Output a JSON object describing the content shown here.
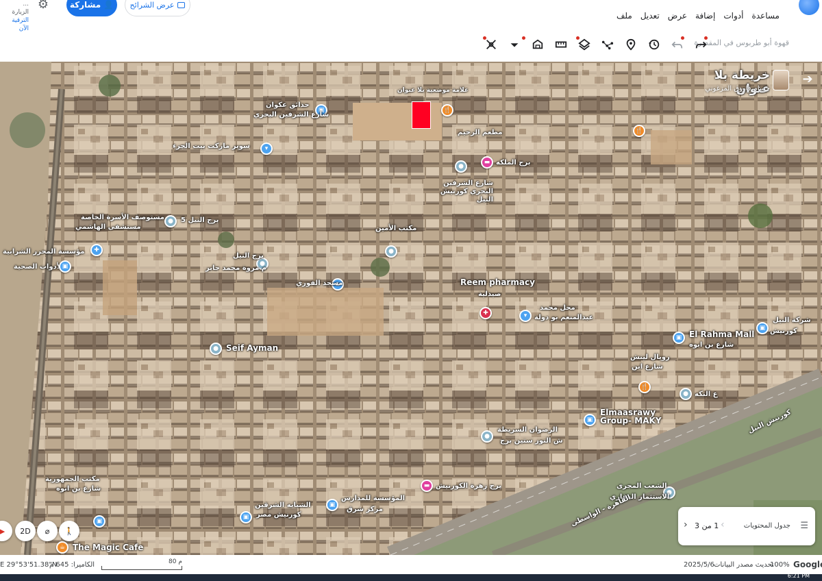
{
  "app": {
    "left_info": [
      "...",
      "الزيارة",
      "الترقية الآن"
    ],
    "share_label": "مشاركة",
    "slides_label": "عرض الشرائح",
    "menu": [
      "ملف",
      "تعديل",
      "عرض",
      "إضافة",
      "أدوات",
      "مساعدة"
    ],
    "search_placeholder": "قهوة أبو طربوس في المقصرة"
  },
  "toolbar_icons": [
    "redo-icon",
    "undo-icon",
    "history-icon",
    "place-marker-icon",
    "path-icon",
    "layers-icon",
    "ruler-icon",
    "home-view-icon",
    "more-icon",
    "satellite-off-icon"
  ],
  "map_title": {
    "name": "خريطة بلا عنوان",
    "author": "حسام فاروق المزغوني"
  },
  "places": [
    {
      "label": "حدائق عكوان",
      "sub": "شارع الشرفين البحري",
      "pin": "blue"
    },
    {
      "label": "علامة موضعية بلا عنوان",
      "sub": "",
      "pin": "orange"
    },
    {
      "label": "مطعم الرحيم",
      "sub": "",
      "pin": "orange"
    },
    {
      "label": "سوبر ماركت بيت الجزء",
      "sub": "",
      "pin": "blue"
    },
    {
      "label": "برج الملكه",
      "sub": "",
      "pin": "pink"
    },
    {
      "label": "شارع الشرفين البحري كورنيش النيل",
      "sub": "",
      "pin": "grey"
    },
    {
      "label": "برج النيل 5",
      "sub": "",
      "pin": "grey"
    },
    {
      "label": "مستوصف الأسرة الخاصة",
      "sub": "مستشفى الهاشمي",
      "pin": "blue"
    },
    {
      "label": "مؤسسة المحرر الشرابية",
      "sub": "والأدوات الصحية",
      "pin": "blue"
    },
    {
      "label": "برج النيل",
      "sub": "م مروة محمد جابر",
      "pin": "grey"
    },
    {
      "label": "مكتب الأمين",
      "sub": "",
      "pin": "grey"
    },
    {
      "label": "مسجد الفوري",
      "sub": "",
      "pin": "blue"
    },
    {
      "label": "Reem pharmacy",
      "sub": "صيدلية",
      "pin": "red"
    },
    {
      "label": "محل محمد",
      "sub": "عبدالمنعم بو دولة",
      "pin": "blue"
    },
    {
      "label": "Seif Ayman",
      "sub": "",
      "pin": "grey"
    },
    {
      "label": "El Rahma Mall",
      "sub": "شارع بن ابوه",
      "pin": "blue"
    },
    {
      "label": "شركة النيل",
      "sub": "كورنيش",
      "pin": "blue"
    },
    {
      "label": "رويال لينش",
      "sub": "شارع ابن",
      "pin": "orange"
    },
    {
      "label": "ع النكه",
      "sub": "",
      "pin": "grey"
    },
    {
      "label": "Elmaasrawy Group- MAKY",
      "sub": "",
      "pin": "blue"
    },
    {
      "label": "الرضوان السريطة",
      "sub": "ش النور ستين برج",
      "pin": "grey"
    },
    {
      "label": "برج زهرة الكورنيش",
      "sub": "",
      "pin": "pink"
    },
    {
      "label": "المؤسسة للمدارس",
      "sub": "مركز شرق",
      "pin": "blue"
    },
    {
      "label": "الشبابه الشرقين",
      "sub": "كورنيش مصر",
      "pin": "blue"
    },
    {
      "label": "مكتب الجمهورية",
      "sub": "شارع بن ابوه",
      "pin": "blue"
    },
    {
      "label": "الشعب المجرى",
      "sub": "الاستثمار العقاري",
      "pin": "grey"
    },
    {
      "label": "The Magic Cafe",
      "sub": "",
      "pin": "orange"
    }
  ],
  "roads": [
    "كورنيش النيل",
    "القاهرة - الواسطى"
  ],
  "map_controls": {
    "view_mode": "2D"
  },
  "toc": {
    "title": "جدول المحتويات",
    "page": "1 من 3"
  },
  "status": {
    "coords": "E 29°53'51.38\"N",
    "camera": "الكاميرا: 645 م",
    "scale": "80 م",
    "date": "2025/5/6",
    "source": "تحديث مصدر البيانات",
    "zoom": "100%",
    "brand": "Google"
  },
  "taskbar": {
    "clock": "6:21 PM"
  },
  "colors": {
    "accent": "#1a73e8",
    "marker_red": "#ff0022"
  }
}
